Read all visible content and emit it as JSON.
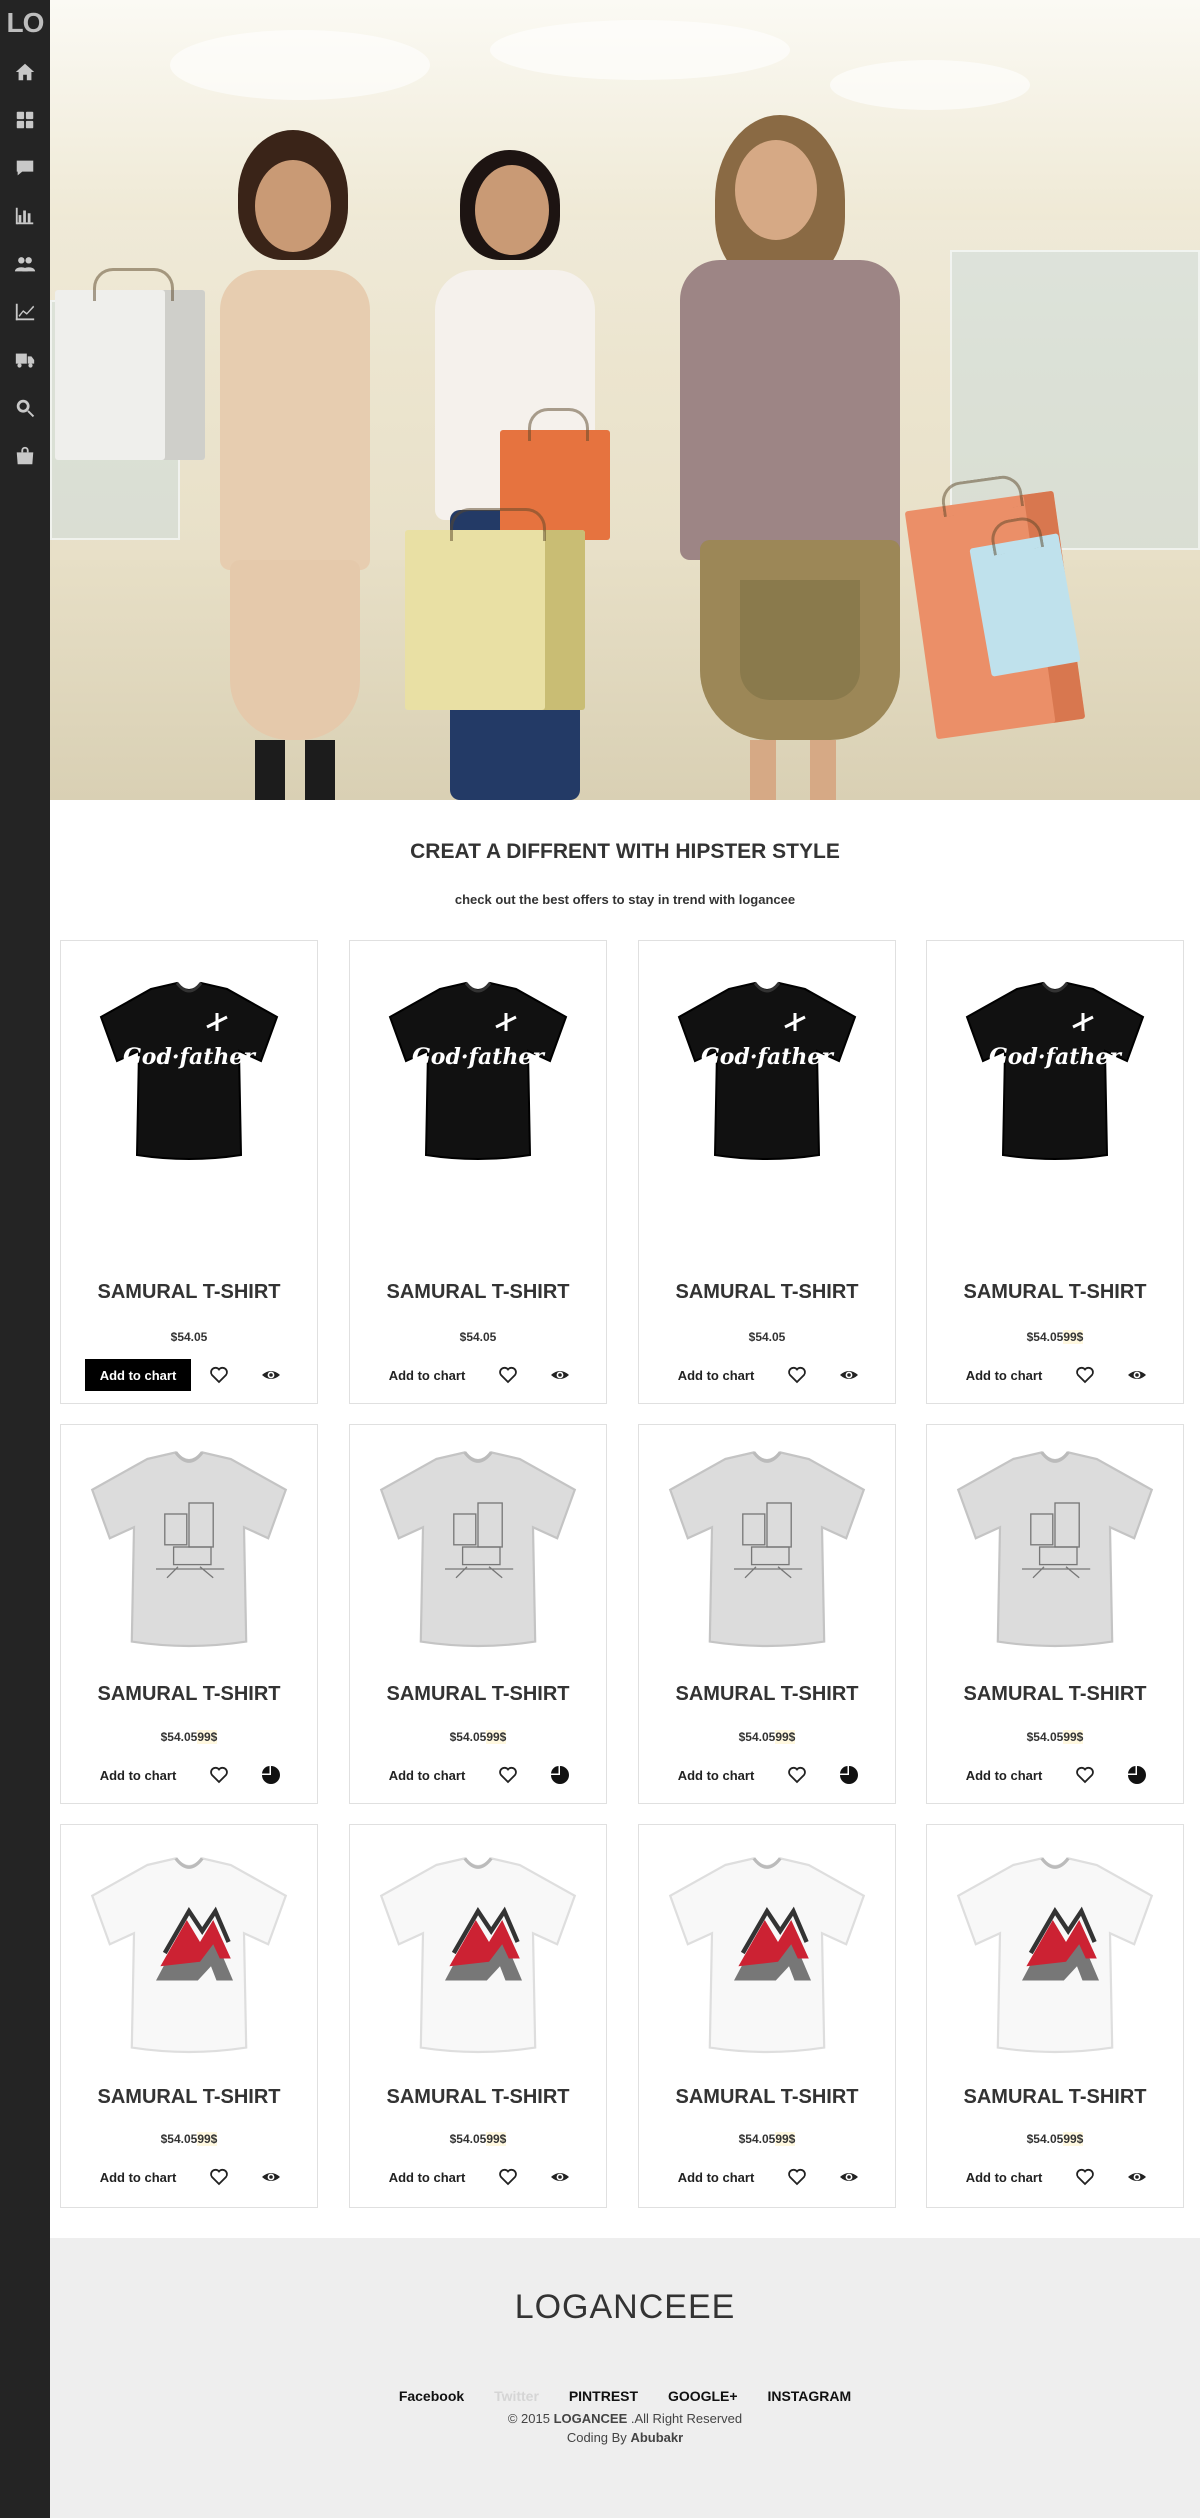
{
  "app": {
    "logo": "LO"
  },
  "sidebar": {
    "items": [
      {
        "icon": "home-icon"
      },
      {
        "icon": "dashboard-icon"
      },
      {
        "icon": "comments-icon"
      },
      {
        "icon": "bar-chart-icon"
      },
      {
        "icon": "users-icon"
      },
      {
        "icon": "line-chart-icon"
      },
      {
        "icon": "truck-icon"
      },
      {
        "icon": "search-icon"
      },
      {
        "icon": "shopping-bag-icon"
      }
    ]
  },
  "hero": {
    "image": "shopping-women-hero-image"
  },
  "section": {
    "title": "CREAT A DIFFRENT WITH HIPSTER STYLE",
    "subtitle": "check out the best offers to stay in trend with logancee"
  },
  "products": [
    {
      "name": "SAMURAL T-SHIRT",
      "price": "$54.05",
      "old_price": "",
      "add_label": "Add to chart",
      "style": "black"
    },
    {
      "name": "SAMURAL T-SHIRT",
      "price": "$54.05",
      "old_price": "",
      "add_label": "Add to chart",
      "style": "black"
    },
    {
      "name": "SAMURAL T-SHIRT",
      "price": "$54.05",
      "old_price": "",
      "add_label": "Add to chart",
      "style": "black"
    },
    {
      "name": "SAMURAL T-SHIRT",
      "price": "$54.05",
      "old_price": "99$",
      "add_label": "Add to chart",
      "style": "black"
    },
    {
      "name": "SAMURAL T-SHIRT",
      "price": "$54.05",
      "old_price": "99$",
      "add_label": "Add to chart",
      "style": "grey"
    },
    {
      "name": "SAMURAL T-SHIRT",
      "price": "$54.05",
      "old_price": "99$",
      "add_label": "Add to chart",
      "style": "grey"
    },
    {
      "name": "SAMURAL T-SHIRT",
      "price": "$54.05",
      "old_price": "99$",
      "add_label": "Add to chart",
      "style": "grey"
    },
    {
      "name": "SAMURAL T-SHIRT",
      "price": "$54.05",
      "old_price": "99$",
      "add_label": "Add to chart",
      "style": "grey"
    },
    {
      "name": "SAMURAL T-SHIRT",
      "price": "$54.05",
      "old_price": "99$",
      "add_label": "Add to chart",
      "style": "white"
    },
    {
      "name": "SAMURAL T-SHIRT",
      "price": "$54.05",
      "old_price": "99$",
      "add_label": "Add to chart",
      "style": "white"
    },
    {
      "name": "SAMURAL T-SHIRT",
      "price": "$54.05",
      "old_price": "99$",
      "add_label": "Add to chart",
      "style": "white"
    },
    {
      "name": "SAMURAL T-SHIRT",
      "price": "$54.05",
      "old_price": "99$",
      "add_label": "Add to chart",
      "style": "white"
    }
  ],
  "footer": {
    "brand": "LOGANCEEE",
    "links": [
      "Facebook",
      "Twitter",
      "PINTREST",
      "GOOGLE+",
      "INSTAGRAM"
    ],
    "copyright_prefix": "© 2015",
    "copyright_brand": "LOGANCEE",
    "copyright_suffix": ".All Right Reserved",
    "credit_prefix": "Coding By",
    "credit_name": "Abubakr"
  }
}
